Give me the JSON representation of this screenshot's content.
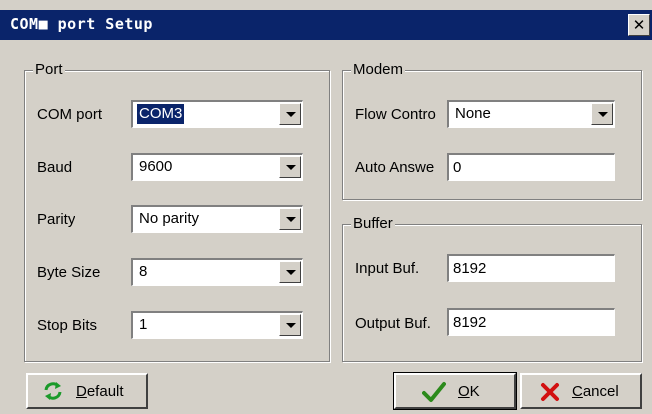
{
  "window": {
    "title": "COM■ port Setup",
    "close_glyph": "✕"
  },
  "port": {
    "legend": "Port",
    "com_port": {
      "label": "COM port",
      "value": "COM3"
    },
    "baud": {
      "label": "Baud",
      "value": "9600"
    },
    "parity": {
      "label": "Parity",
      "value": "No parity"
    },
    "byte_size": {
      "label": "Byte Size",
      "value": "8"
    },
    "stop_bits": {
      "label": "Stop Bits",
      "value": "1"
    }
  },
  "modem": {
    "legend": "Modem",
    "flow_control": {
      "label": "Flow Contro",
      "value": "None"
    },
    "auto_answer": {
      "label": "Auto Answe",
      "value": "0"
    }
  },
  "buffer": {
    "legend": "Buffer",
    "input_buf": {
      "label": "Input Buf.",
      "value": "8192"
    },
    "output_buf": {
      "label": "Output Buf.",
      "value": "8192"
    }
  },
  "buttons": {
    "default": {
      "accel": "D",
      "rest": "efault",
      "icon": "refresh-icon",
      "icon_color": "#1a9a2a"
    },
    "ok": {
      "accel": "O",
      "rest": "K",
      "icon": "checkmark-icon",
      "icon_color": "#2c8a1c"
    },
    "cancel": {
      "accel": "C",
      "rest": "ancel",
      "icon": "cross-icon",
      "icon_color": "#d21010"
    }
  }
}
